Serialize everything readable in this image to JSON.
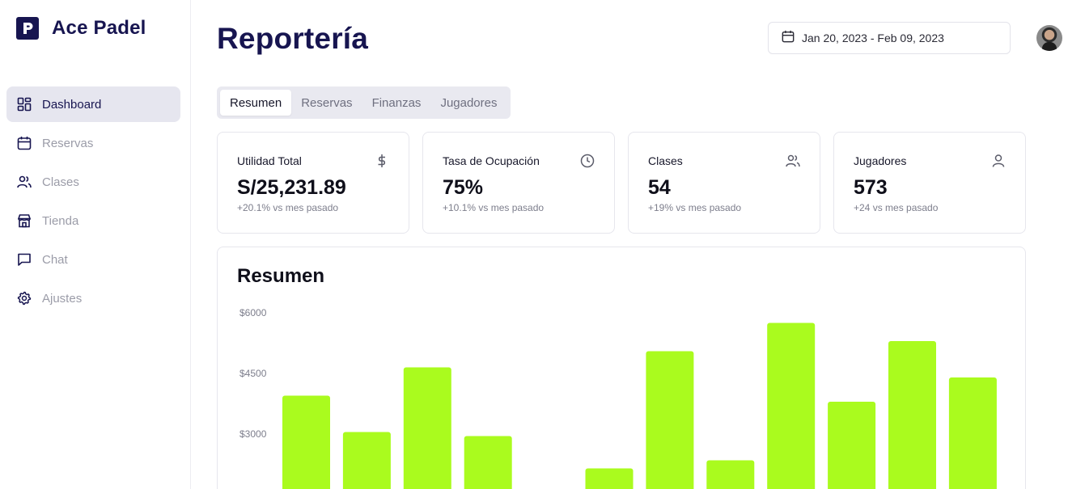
{
  "brand": {
    "name": "Ace Padel",
    "logo_letter": "P"
  },
  "sidebar": {
    "items": [
      {
        "label": "Dashboard",
        "icon": "dashboard-icon",
        "active": true
      },
      {
        "label": "Reservas",
        "icon": "calendar-icon",
        "active": false
      },
      {
        "label": "Clases",
        "icon": "users-icon",
        "active": false
      },
      {
        "label": "Tienda",
        "icon": "store-icon",
        "active": false
      },
      {
        "label": "Chat",
        "icon": "chat-icon",
        "active": false
      },
      {
        "label": "Ajustes",
        "icon": "gear-icon",
        "active": false
      }
    ]
  },
  "header": {
    "title": "Reportería",
    "date_range": "Jan 20, 2023 - Feb 09, 2023"
  },
  "tabs": [
    {
      "label": "Resumen",
      "active": true
    },
    {
      "label": "Reservas",
      "active": false
    },
    {
      "label": "Finanzas",
      "active": false
    },
    {
      "label": "Jugadores",
      "active": false
    }
  ],
  "stats": [
    {
      "title": "Utilidad Total",
      "value": "S/25,231.89",
      "sub": "+20.1% vs mes pasado",
      "icon": "dollar-icon"
    },
    {
      "title": "Tasa de Ocupación",
      "value": "75%",
      "sub": "+10.1% vs mes pasado",
      "icon": "clock-icon"
    },
    {
      "title": "Clases",
      "value": "54",
      "sub": "+19% vs mes pasado",
      "icon": "users-icon"
    },
    {
      "title": "Jugadores",
      "value": "573",
      "sub": "+24 vs mes pasado",
      "icon": "user-icon"
    }
  ],
  "overview": {
    "title": "Resumen"
  },
  "colors": {
    "brand": "#171550",
    "bar": "#aafb1e",
    "muted": "#9b9ca8"
  },
  "chart_data": {
    "type": "bar",
    "title": "Resumen",
    "ytick_labels": [
      "$6000",
      "$4500",
      "$3000"
    ],
    "yticks": [
      6000,
      4500,
      3000
    ],
    "ylim": [
      0,
      6000
    ],
    "values": [
      3950,
      3050,
      4650,
      2950,
      null,
      2150,
      5050,
      2350,
      5750,
      3800,
      5300,
      4400
    ]
  }
}
